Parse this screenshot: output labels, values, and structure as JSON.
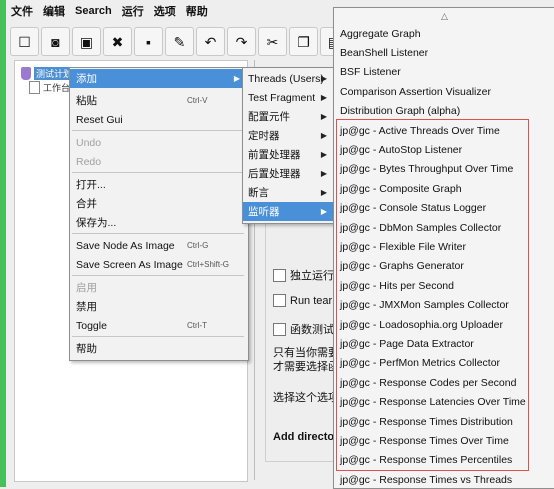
{
  "menubar": [
    "文件",
    "编辑",
    "Search",
    "运行",
    "选项",
    "帮助"
  ],
  "toolbar": [
    {
      "icon": "new-icon",
      "glyph": "☐"
    },
    {
      "icon": "templates-icon",
      "glyph": "◙"
    },
    {
      "icon": "open-icon",
      "glyph": "▣"
    },
    {
      "icon": "close-icon",
      "glyph": "✖"
    },
    {
      "icon": "save-icon",
      "glyph": "▪"
    },
    {
      "icon": "save-as-icon",
      "glyph": "✎"
    },
    {
      "icon": "undo-icon",
      "glyph": "↶"
    },
    {
      "icon": "redo-icon",
      "glyph": "↷"
    },
    {
      "icon": "cut-icon",
      "glyph": "✂"
    },
    {
      "icon": "copy-icon",
      "glyph": "❐"
    },
    {
      "icon": "paste-icon",
      "glyph": "▤"
    }
  ],
  "tree": {
    "node1": "测试计划",
    "node2": "工作台"
  },
  "context_menu": {
    "items": [
      {
        "label": "添加",
        "shortcut": "",
        "selected": true,
        "disabled": false,
        "submenu": true
      },
      {
        "label": "粘贴",
        "shortcut": "Ctrl-V"
      },
      {
        "label": "Reset Gui",
        "shortcut": ""
      },
      {
        "label": "Undo",
        "shortcut": "",
        "disabled": true
      },
      {
        "label": "Redo",
        "shortcut": "",
        "disabled": true
      },
      {
        "label": "打开...",
        "shortcut": ""
      },
      {
        "label": "合并",
        "shortcut": ""
      },
      {
        "label": "保存为...",
        "shortcut": ""
      },
      {
        "label": "Save Node As Image",
        "shortcut": "Ctrl-G"
      },
      {
        "label": "Save Screen As Image",
        "shortcut": "Ctrl+Shift-G"
      },
      {
        "label": "启用",
        "shortcut": "",
        "disabled": true
      },
      {
        "label": "禁用",
        "shortcut": ""
      },
      {
        "label": "Toggle",
        "shortcut": "Ctrl-T"
      },
      {
        "label": "帮助",
        "shortcut": ""
      }
    ]
  },
  "submenu1": {
    "items": [
      {
        "label": "Threads (Users)"
      },
      {
        "label": "Test Fragment"
      },
      {
        "label": "配置元件"
      },
      {
        "label": "定时器"
      },
      {
        "label": "前置处理器"
      },
      {
        "label": "后置处理器"
      },
      {
        "label": "断言"
      },
      {
        "label": "监听器",
        "selected": true
      }
    ]
  },
  "submenu2": {
    "scroll_up": "△",
    "items": [
      "Aggregate Graph",
      "BeanShell Listener",
      "BSF Listener",
      "Comparison Assertion Visualizer",
      "Distribution Graph (alpha)",
      "jp@gc - Active Threads Over Time",
      "jp@gc - AutoStop Listener",
      "jp@gc - Bytes Throughput Over Time",
      "jp@gc - Composite Graph",
      "jp@gc - Console Status Logger",
      "jp@gc - DbMon Samples Collector",
      "jp@gc - Flexible File Writer",
      "jp@gc - Graphs Generator",
      "jp@gc - Hits per Second",
      "jp@gc - JMXMon Samples Collector",
      "jp@gc - Loadosophia.org Uploader",
      "jp@gc - Page Data Extractor",
      "jp@gc - PerfMon Metrics Collector",
      "jp@gc - Response Codes per Second",
      "jp@gc - Response Latencies Over Time",
      "jp@gc - Response Times Distribution",
      "jp@gc - Response Times Over Time",
      "jp@gc - Response Times Percentiles",
      "jp@gc - Response Times vs Threads"
    ]
  },
  "right_panel": {
    "cb1": "独立运行",
    "cb2": "Run tear",
    "cb3": "函数测试",
    "text1": "只有当你需要",
    "text2": "才需要选择函",
    "text3": "选择这个选项",
    "text4": "Add director"
  },
  "colors": {
    "selection": "#4a90d9",
    "highlight_box": "#e05050",
    "left_bar": "#45c05a"
  }
}
